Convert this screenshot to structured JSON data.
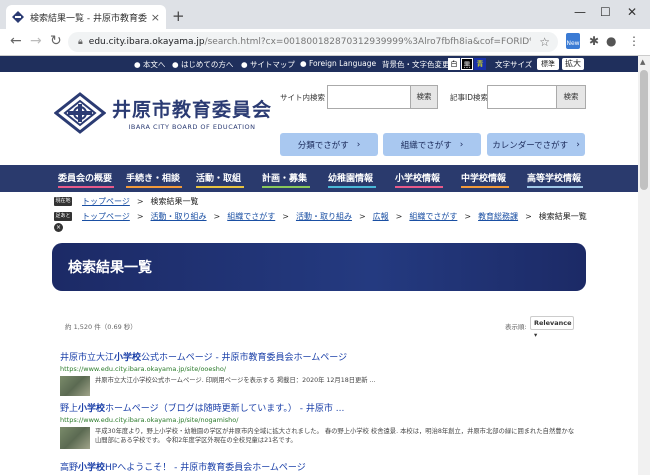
{
  "browser": {
    "tab_title": "検索結果一覧 - 井原市教育委員会",
    "tab_close": "×",
    "new_tab": "+",
    "url_main": "edu.city.ibara.okayama.jp",
    "url_rest": "/search.html?cx=001800182870312939999%3Alro7fbfh8ia&cof=FORID%3A...",
    "win_min": "—",
    "win_max": "☐",
    "win_close": "✕",
    "ext_badge": "New"
  },
  "utility": {
    "links": [
      "本文へ",
      "はじめての方へ",
      "サイトマップ",
      "Foreign Language"
    ],
    "color_label": "背景色・文字色変更",
    "color_buttons": [
      "白",
      "黒",
      "青"
    ],
    "font_label": "文字サイズ",
    "font_buttons": [
      "標準",
      "拡大"
    ]
  },
  "header": {
    "logo_jp": "井原市教育委員会",
    "logo_en": "IBARA CITY BOARD OF EDUCATION",
    "site_search_label": "サイト内検索",
    "site_search_button": "検索",
    "article_search_label": "記事ID検索",
    "article_search_button": "検索",
    "category_buttons": [
      "分類でさがす",
      "組織でさがす",
      "カレンダーでさがす"
    ]
  },
  "global_nav": [
    {
      "label": "委員会の概要",
      "color": "#e85a8a"
    },
    {
      "label": "手続き・相談",
      "color": "#f29a3a"
    },
    {
      "label": "活動・取組",
      "color": "#e8c440"
    },
    {
      "label": "計画・募集",
      "color": "#8ac85a"
    },
    {
      "label": "幼稚園情報",
      "color": "#4ab8d8"
    },
    {
      "label": "小学校情報",
      "color": "#e85a8a"
    },
    {
      "label": "中学校情報",
      "color": "#f29a3a"
    },
    {
      "label": "高等学校情報",
      "color": "#a0c8e8"
    }
  ],
  "breadcrumbs": {
    "current_label": "現在地",
    "current_path": [
      "トップページ",
      "検索結果一覧"
    ],
    "history_label": "足あと",
    "history_path": [
      "トップページ",
      "活動・取り組み",
      "組織でさがす",
      "活動・取り組み",
      "広報",
      "組織でさがす",
      "教育総務課",
      "検索結果一覧"
    ],
    "separator": ">",
    "close_icon": "×"
  },
  "page_title": "検索結果一覧",
  "results": {
    "count_text": "約 1,520 件（0.69 秒）",
    "sort_label": "表示順:",
    "sort_value": "Relevance",
    "items": [
      {
        "title_pre": "井原市立大江",
        "title_bold": "小学校",
        "title_post": "公式ホームページ - 井原市教育委員会ホームページ",
        "url": "https://www.edu.city.ibara.okayama.jp/site/ooesho/",
        "snippet": "井原市立大江小学校公式ホームページ. 印刷用ページを表示する 掲載日：2020年 12月18日更新 ..."
      },
      {
        "title_pre": "野上",
        "title_bold": "小学校",
        "title_post": "ホームページ（ブログは随時更新しています。） - 井原市 ...",
        "url": "https://www.edu.city.ibara.okayama.jp/site/nogamisho/",
        "snippet": "平成30年度より，野上小学校・幼稚園の学区が井原市内全域に拡大されました。 春の野上小学校 校舎遠景. 本校は，明治8年創立，井原市北部の緑に囲まれた自然豊かな山間部にある学校です。 令和2年度学区外現在の全校児童は21名です。"
      },
      {
        "title_pre": "高野",
        "title_bold": "小学校",
        "title_post": "HPへようこそ！ - 井原市教育委員会ホームページ",
        "url": "",
        "snippet": ""
      }
    ]
  }
}
